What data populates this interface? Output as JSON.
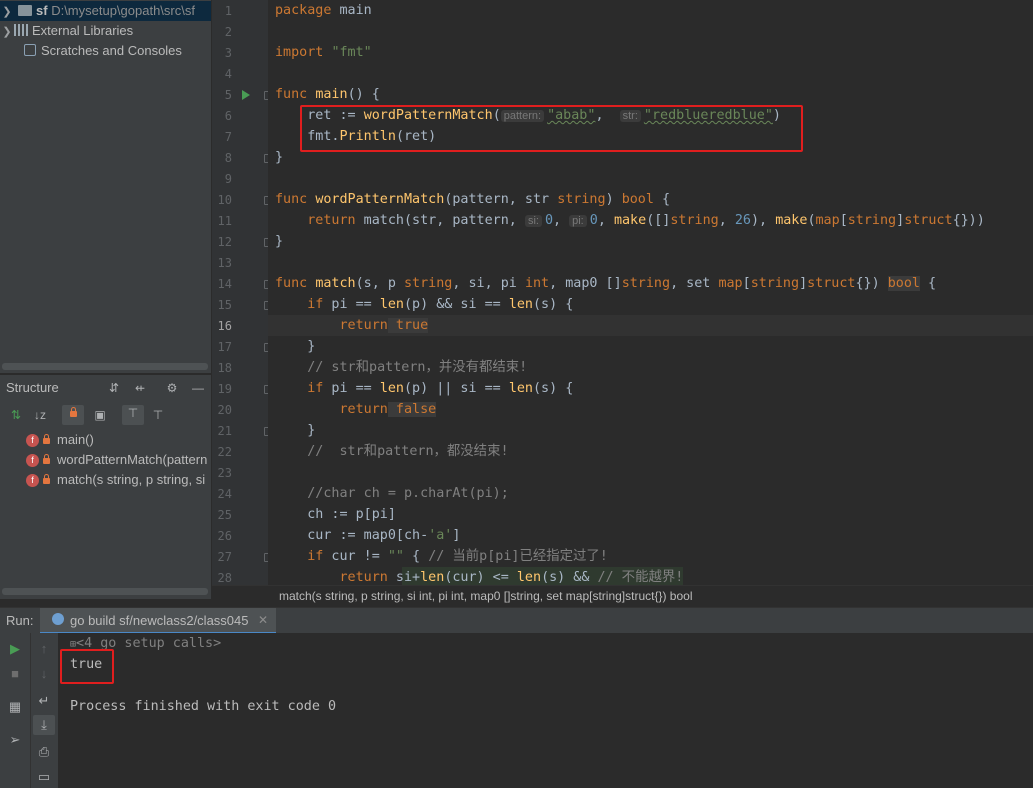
{
  "project_tree": {
    "root": {
      "name": "sf",
      "path": "D:\\mysetup\\gopath\\src\\sf"
    },
    "items": [
      {
        "label": "External Libraries"
      },
      {
        "label": "Scratches and Consoles"
      }
    ]
  },
  "structure": {
    "title": "Structure",
    "items": [
      {
        "label": "main()"
      },
      {
        "label": "wordPatternMatch(pattern"
      },
      {
        "label": "match(s string, p string, si"
      }
    ]
  },
  "editor": {
    "line_numbers": [
      "1",
      "2",
      "3",
      "4",
      "5",
      "6",
      "7",
      "8",
      "9",
      "10",
      "11",
      "12",
      "13",
      "14",
      "15",
      "16",
      "17",
      "18",
      "19",
      "20",
      "21",
      "22",
      "23",
      "24",
      "25",
      "26",
      "27",
      "28"
    ],
    "current_line": 16,
    "code": {
      "l1_kw": "package",
      "l1_rest": " main",
      "l3_kw": "import",
      "l3_str": "\"fmt\"",
      "l5_kw": "func",
      "l5_fn": "main",
      "l5_rest": "() {",
      "l6_a": "    ret := ",
      "l6_call": "wordPatternMatch",
      "l6_b": "(",
      "l6_hint1": "pattern:",
      "l6_s1": "\"abab\"",
      "l6_c": ",  ",
      "l6_hint2": "str:",
      "l6_s2": "\"redblueredblue\"",
      "l6_d": ")",
      "l7_a": "    fmt.",
      "l7_call": "Println",
      "l7_b": "(ret)",
      "l8": "}",
      "l10_kw": "func",
      "l10_fn": "wordPatternMatch",
      "l10_a": "(pattern, str ",
      "l10_t1": "string",
      "l10_b": ") ",
      "l10_t2": "bool",
      "l10_c": " {",
      "l11_kw": "    return",
      "l11_a": " match(str, pattern, ",
      "l11_h1": "si:",
      "l11_n1": "0",
      "l11_b": ", ",
      "l11_h2": "pi:",
      "l11_n2": "0",
      "l11_c": ", ",
      "l11_mk1": "make",
      "l11_d": "([]",
      "l11_t1": "string",
      "l11_e": ", ",
      "l11_n3": "26",
      "l11_f": "), ",
      "l11_mk2": "make",
      "l11_g": "(",
      "l11_t2": "map",
      "l11_h": "[",
      "l11_t3": "string",
      "l11_i": "]",
      "l11_t4": "struct",
      "l11_j": "{}))",
      "l12": "}",
      "l14_kw": "func",
      "l14_fn": "match",
      "l14_a": "(s, p ",
      "l14_t1": "string",
      "l14_b": ", si, pi ",
      "l14_t2": "int",
      "l14_c": ", map0 []",
      "l14_t3": "string",
      "l14_d": ", set ",
      "l14_t4": "map",
      "l14_e": "[",
      "l14_t5": "string",
      "l14_f": "]",
      "l14_t6": "struct",
      "l14_g": "{}) ",
      "l14_t7": "bool",
      "l14_h": " {",
      "l15_kw": "    if",
      "l15_a": " pi == ",
      "l15_b1": "len",
      "l15_c": "(p) && si == ",
      "l15_b2": "len",
      "l15_d": "(s) {",
      "l16_kw": "        return",
      "l16_v": " true",
      "l17": "    }",
      "l18_cm": "    // str和pattern，并没有都结束!",
      "l19_kw": "    if",
      "l19_a": " pi == ",
      "l19_b1": "len",
      "l19_c": "(p) || si == ",
      "l19_b2": "len",
      "l19_d": "(s) {",
      "l20_kw": "        return",
      "l20_v": " false",
      "l21": "    }",
      "l22_cm": "    //  str和pattern，都没结束!",
      "l24_cm": "    //char ch = p.charAt(pi);",
      "l25": "    ch := p[pi]",
      "l26_a": "    cur := map0[ch-",
      "l26_s": "'a'",
      "l26_b": "]",
      "l27_kw": "    if",
      "l27_a": " cur != ",
      "l27_s": "\"\"",
      "l27_b": " { ",
      "l27_cm": "// 当前p[pi]已经指定过了!",
      "l28_kw": "        return",
      "l28_a": " si+",
      "l28_b1": "len",
      "l28_b": "(cur) <= ",
      "l28_b2": "len",
      "l28_c": "(s) && ",
      "l28_cm": "// 不能越界!"
    }
  },
  "breadcrumb": "match(s string, p string, si int, pi int, map0 []string, set map[string]struct{}) bool",
  "run": {
    "label": "Run:",
    "tab_label": "go build sf/newclass2/class045",
    "console": {
      "setup_calls": "<4 go setup calls>",
      "output": "true",
      "finished": "Process finished with exit code 0"
    }
  },
  "colors": {
    "highlight_box": "#e01e1e",
    "keyword": "#cc7832",
    "function": "#ffc66d",
    "string": "#6a8759",
    "number": "#6897bb",
    "comment": "#808080"
  }
}
